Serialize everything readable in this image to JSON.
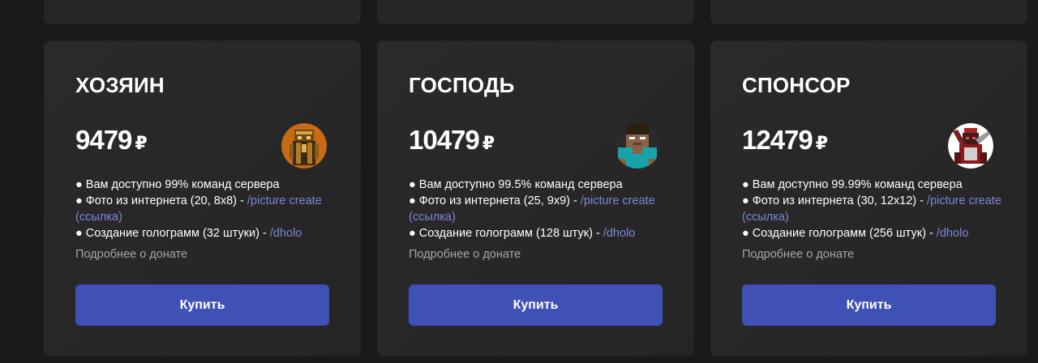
{
  "cards": [
    {
      "title": "ХОЗЯИН",
      "price": "9479",
      "currency": "₽",
      "avatar_icon": "golden-armor-skin-avatar",
      "features": [
        {
          "text": "● Вам доступно 99% команд сервера",
          "cmd": ""
        },
        {
          "text": "● Фото из интернета (20, 8x8) - ",
          "cmd": "/picture create (ссылка)"
        },
        {
          "text": "● Создание голограмм (32 штуки) - ",
          "cmd": "/dholo"
        }
      ],
      "more": "Подробнее о донате",
      "button": "Купить"
    },
    {
      "title": "ГОСПОДЬ",
      "price": "10479",
      "currency": "₽",
      "avatar_icon": "herobrine-skin-avatar",
      "features": [
        {
          "text": "● Вам доступно 99.5% команд сервера",
          "cmd": ""
        },
        {
          "text": "● Фото из интернета (25, 9x9) - ",
          "cmd": "/picture create (ссылка)"
        },
        {
          "text": "● Создание голограмм (128 штук) - ",
          "cmd": "/dholo"
        }
      ],
      "more": "Подробнее о донате",
      "button": "Купить"
    },
    {
      "title": "СПОНСОР",
      "price": "12479",
      "currency": "₽",
      "avatar_icon": "red-armor-skin-avatar",
      "features": [
        {
          "text": "● Вам доступно 99.99% команд сервера",
          "cmd": ""
        },
        {
          "text": "● Фото из интернета (30, 12x12) - ",
          "cmd": "/picture create (ссылка)"
        },
        {
          "text": "● Создание голограмм (256 штук) - ",
          "cmd": "/dholo"
        }
      ],
      "more": "Подробнее о донате",
      "button": "Купить"
    }
  ],
  "colors": {
    "background": "#1a1a1a",
    "card": "#2a2a2a",
    "accent_button": "#3f51b5",
    "command_link": "#7d87d8",
    "muted_text": "#a6a6a6"
  }
}
